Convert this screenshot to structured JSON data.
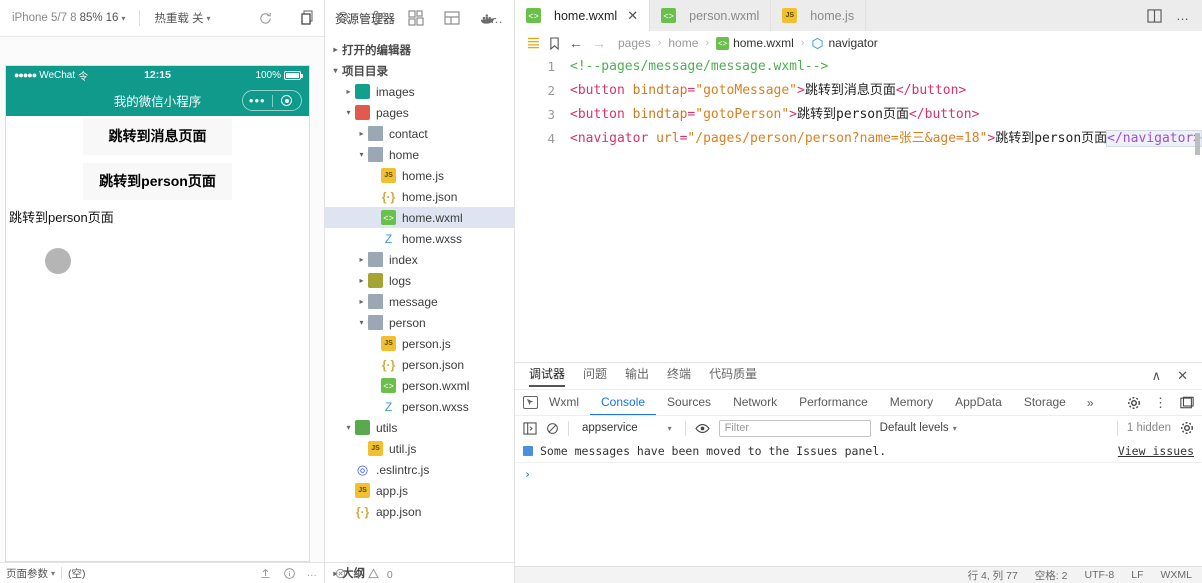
{
  "simulator": {
    "toolbar": {
      "device": "iPhone 5/7 8",
      "scale": "85%",
      "font_size": "16",
      "hotreload_label": "热重载",
      "hotreload_value": "关"
    },
    "status_bar": {
      "carrier": "WeChat",
      "signal_dots": "●●●●●",
      "wifi": "令",
      "time": "12:15",
      "battery": "100%"
    },
    "navbar": {
      "title": "我的微信小程序"
    },
    "page": {
      "button1": "跳转到消息页面",
      "button2": "跳转到person页面",
      "navigator_text": "跳转到person页面"
    },
    "bottom_bar": {
      "params_label": "页面参数",
      "params_value": "(空)"
    },
    "problems": {
      "errors": "0",
      "warnings": "0"
    }
  },
  "header_icons": {
    "refresh": "refresh-icon",
    "more": "more-icon",
    "files": "files-icon",
    "search": "search-icon",
    "git": "git-branch-icon",
    "extensions": "extensions-icon",
    "layout": "layout-icon",
    "docker": "docker-icon",
    "split": "split-editor-icon",
    "overflow": "more-actions-icon"
  },
  "explorer": {
    "title": "资源管理器",
    "sections": {
      "open_editors": "打开的编辑器",
      "project_dir": "项目目录",
      "outline": "大纲"
    },
    "tree": [
      {
        "label": "images",
        "indent": 1,
        "type": "folder-teal",
        "arrow": "▸",
        "selected": false
      },
      {
        "label": "pages",
        "indent": 1,
        "type": "folder-red",
        "arrow": "▾",
        "selected": false
      },
      {
        "label": "contact",
        "indent": 2,
        "type": "folder-blue",
        "arrow": "▸",
        "selected": false
      },
      {
        "label": "home",
        "indent": 2,
        "type": "folder-blue",
        "arrow": "▾",
        "selected": false
      },
      {
        "label": "home.js",
        "indent": 3,
        "type": "js",
        "arrow": "",
        "selected": false
      },
      {
        "label": "home.json",
        "indent": 3,
        "type": "json",
        "arrow": "",
        "selected": false
      },
      {
        "label": "home.wxml",
        "indent": 3,
        "type": "wxml",
        "arrow": "",
        "selected": true
      },
      {
        "label": "home.wxss",
        "indent": 3,
        "type": "wxss",
        "arrow": "",
        "selected": false
      },
      {
        "label": "index",
        "indent": 2,
        "type": "folder-blue",
        "arrow": "▸",
        "selected": false
      },
      {
        "label": "logs",
        "indent": 2,
        "type": "folder-olive",
        "arrow": "▸",
        "selected": false
      },
      {
        "label": "message",
        "indent": 2,
        "type": "folder-blue",
        "arrow": "▸",
        "selected": false
      },
      {
        "label": "person",
        "indent": 2,
        "type": "folder-blue",
        "arrow": "▾",
        "selected": false
      },
      {
        "label": "person.js",
        "indent": 3,
        "type": "js",
        "arrow": "",
        "selected": false
      },
      {
        "label": "person.json",
        "indent": 3,
        "type": "json",
        "arrow": "",
        "selected": false
      },
      {
        "label": "person.wxml",
        "indent": 3,
        "type": "wxml",
        "arrow": "",
        "selected": false
      },
      {
        "label": "person.wxss",
        "indent": 3,
        "type": "wxss",
        "arrow": "",
        "selected": false
      },
      {
        "label": "utils",
        "indent": 1,
        "type": "folder-green",
        "arrow": "▾",
        "selected": false
      },
      {
        "label": "util.js",
        "indent": 2,
        "type": "js",
        "arrow": "",
        "selected": false
      },
      {
        "label": ".eslintrc.js",
        "indent": 1,
        "type": "eslint",
        "arrow": "",
        "selected": false
      },
      {
        "label": "app.js",
        "indent": 1,
        "type": "js",
        "arrow": "",
        "selected": false
      },
      {
        "label": "app.json",
        "indent": 1,
        "type": "json",
        "arrow": "",
        "selected": false
      }
    ]
  },
  "editor": {
    "tabs": [
      {
        "label": "home.wxml",
        "icon": "wxml",
        "active": true
      },
      {
        "label": "person.wxml",
        "icon": "wxml",
        "active": false
      },
      {
        "label": "home.js",
        "icon": "js",
        "active": false
      }
    ],
    "close_glyph": "✕",
    "breadcrumb": [
      {
        "label": "pages",
        "icon": "none"
      },
      {
        "label": "home",
        "icon": "none"
      },
      {
        "label": "home.wxml",
        "icon": "wxml"
      },
      {
        "label": "navigator",
        "icon": "symbol"
      }
    ],
    "breadcrumb_sep": "›",
    "lines": [
      {
        "n": "1",
        "tokens": [
          {
            "t": "comment",
            "v": "<!--pages/message/message.wxml-->"
          }
        ]
      },
      {
        "n": "2",
        "tokens": [
          {
            "t": "tag",
            "v": "<button"
          },
          {
            "t": "plain",
            "v": " "
          },
          {
            "t": "attr",
            "v": "bindtap"
          },
          {
            "t": "tag",
            "v": "="
          },
          {
            "t": "str",
            "v": "\"gotoMessage\""
          },
          {
            "t": "tag",
            "v": ">"
          },
          {
            "t": "text",
            "v": "跳转到消息页面"
          },
          {
            "t": "tag",
            "v": "</button>"
          }
        ]
      },
      {
        "n": "3",
        "tokens": [
          {
            "t": "tag",
            "v": "<button"
          },
          {
            "t": "plain",
            "v": " "
          },
          {
            "t": "attr",
            "v": "bindtap"
          },
          {
            "t": "tag",
            "v": "="
          },
          {
            "t": "str",
            "v": "\"gotoPerson\""
          },
          {
            "t": "tag",
            "v": ">"
          },
          {
            "t": "text",
            "v": "跳转到person页面"
          },
          {
            "t": "tag",
            "v": "</button>"
          }
        ]
      },
      {
        "n": "4",
        "tokens": [
          {
            "t": "tag",
            "v": "<navigator"
          },
          {
            "t": "plain",
            "v": " "
          },
          {
            "t": "attr",
            "v": "url"
          },
          {
            "t": "tag",
            "v": "="
          },
          {
            "t": "str",
            "v": "\"/pages/person/person?name=张三&age=18\""
          },
          {
            "t": "tag",
            "v": ">"
          },
          {
            "t": "text",
            "v": "跳转到person页面"
          },
          {
            "t": "hltag",
            "v": "</navigator>"
          }
        ]
      }
    ]
  },
  "dock": {
    "tabs": [
      {
        "label": "调试器",
        "active": true
      },
      {
        "label": "问题",
        "active": false
      },
      {
        "label": "输出",
        "active": false
      },
      {
        "label": "终端",
        "active": false
      },
      {
        "label": "代码质量",
        "active": false
      }
    ],
    "collapse_glyph": "∧",
    "close_glyph": "✕",
    "devtools_tabs": [
      {
        "label": "Wxml",
        "active": false
      },
      {
        "label": "Console",
        "active": true
      },
      {
        "label": "Sources",
        "active": false
      },
      {
        "label": "Network",
        "active": false
      },
      {
        "label": "Performance",
        "active": false
      },
      {
        "label": "Memory",
        "active": false
      },
      {
        "label": "AppData",
        "active": false
      },
      {
        "label": "Storage",
        "active": false
      }
    ],
    "overflow_glyph": "»",
    "console": {
      "context": "appservice",
      "filter_placeholder": "Filter",
      "levels": "Default levels",
      "hidden_count": "1 hidden",
      "message": "Some messages have been moved to the Issues panel.",
      "view_issues": "View issues",
      "prompt": "›"
    }
  },
  "status_bar": {
    "position": "行 4, 列 77",
    "indent": "空格: 2",
    "encoding": "UTF-8",
    "eol": "LF",
    "language": "WXML"
  }
}
